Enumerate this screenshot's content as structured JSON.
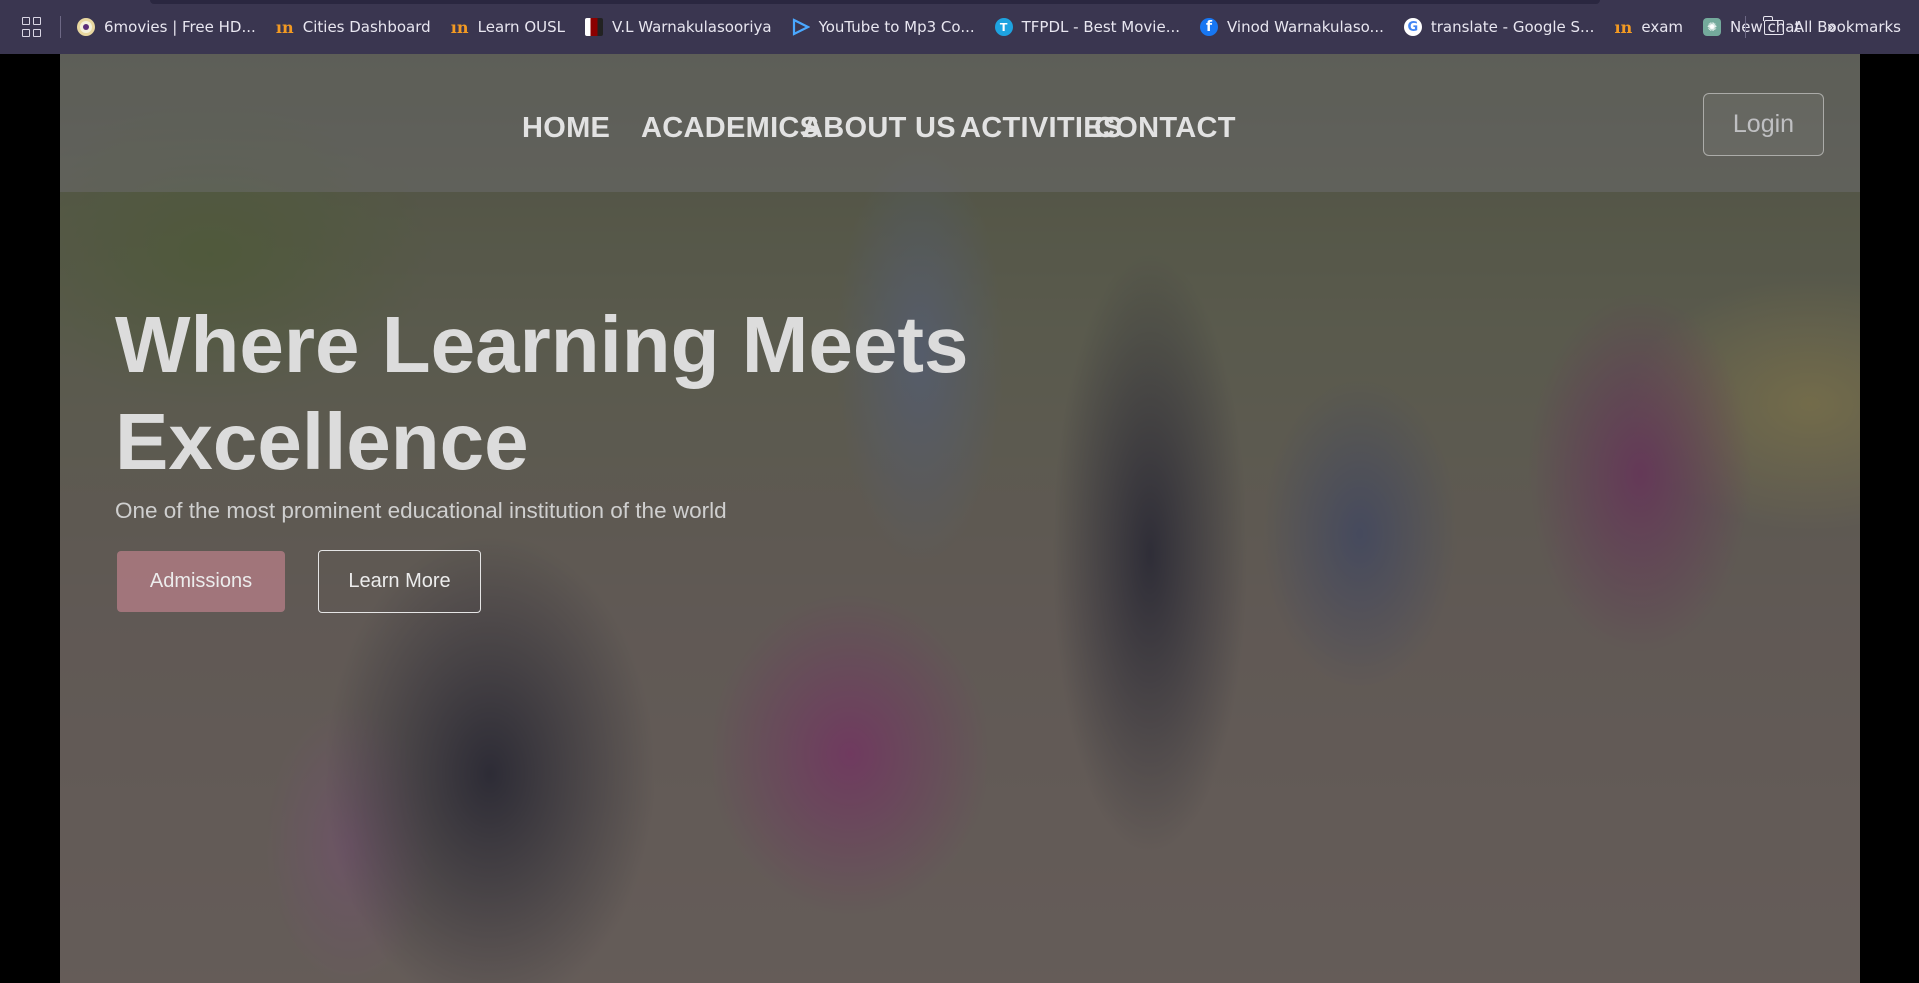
{
  "bookmarks": {
    "items": [
      {
        "label": "6movies | Free HD...",
        "icon": "6movies-favicon"
      },
      {
        "label": "Cities Dashboard",
        "icon": "ousl-favicon"
      },
      {
        "label": "Learn OUSL",
        "icon": "ousl-favicon"
      },
      {
        "label": "V.L Warnakulasooriya",
        "icon": "vl-favicon"
      },
      {
        "label": "YouTube to Mp3 Co...",
        "icon": "youtube-mp3-favicon"
      },
      {
        "label": "TFPDL - Best Movie...",
        "icon": "tfpdl-favicon"
      },
      {
        "label": "Vinod Warnakulaso...",
        "icon": "facebook-favicon"
      },
      {
        "label": "translate - Google S...",
        "icon": "google-favicon"
      },
      {
        "label": "exam",
        "icon": "ousl-favicon"
      },
      {
        "label": "New chat",
        "icon": "chatgpt-favicon"
      }
    ],
    "all_bookmarks_label": "All Bookmarks",
    "fav_glyphs": {
      "tfpdl": "T",
      "facebook": "f",
      "google": "G",
      "ousl": "ın",
      "gpt": "✺"
    }
  },
  "nav": {
    "home": "HOME",
    "academics": "ACADEMICS",
    "about": "ABOUT US",
    "activities": "ACTIVITIES",
    "contact": "CONTACT",
    "login": "Login"
  },
  "hero": {
    "headline": "Where Learning Meets Excellence",
    "subline": "One of the most prominent educational institution of the world",
    "admissions_label": "Admissions",
    "learn_more_label": "Learn More"
  },
  "colors": {
    "bookmarks_bar": "#3a3650",
    "admissions_button": "#be828c",
    "text_light": "#dcdcdc"
  }
}
